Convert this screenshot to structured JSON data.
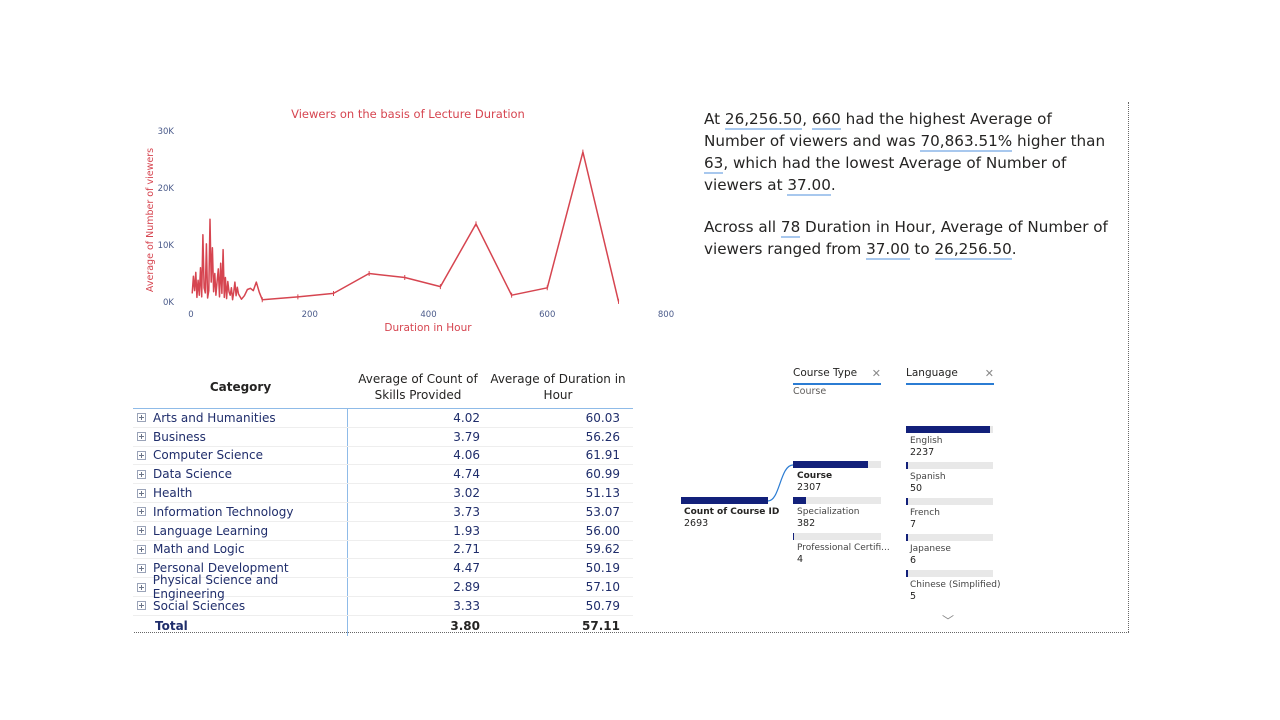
{
  "chart_data": {
    "type": "line",
    "title": "Viewers on the basis of Lecture Duration",
    "xlabel": "Duration in Hour",
    "ylabel": "Average of Number of viewers",
    "xlim": [
      0,
      800
    ],
    "ylim": [
      0,
      30000
    ],
    "x_ticks": [
      "0",
      "200",
      "400",
      "600",
      "800"
    ],
    "y_ticks": [
      "0K",
      "10K",
      "20K",
      "30K"
    ],
    "grid": false,
    "series": [
      {
        "color": "#d64550",
        "x": [
          2,
          4,
          6,
          8,
          10,
          12,
          14,
          16,
          18,
          20,
          22,
          24,
          26,
          28,
          30,
          32,
          34,
          36,
          38,
          40,
          42,
          44,
          46,
          48,
          50,
          52,
          54,
          56,
          58,
          60,
          62,
          64,
          66,
          68,
          70,
          72,
          74,
          76,
          78,
          80,
          85,
          90,
          95,
          100,
          105,
          110,
          115,
          120,
          180,
          240,
          300,
          360,
          420,
          480,
          540,
          600,
          660,
          720
        ],
        "y": [
          1500,
          4500,
          2000,
          5200,
          800,
          3800,
          1200,
          6000,
          900,
          11800,
          2500,
          1600,
          10200,
          700,
          2000,
          14500,
          3500,
          9500,
          1800,
          5000,
          1200,
          3600,
          5800,
          900,
          6800,
          1500,
          9200,
          800,
          4300,
          600,
          3600,
          1800,
          1200,
          2500,
          400,
          1800,
          3500,
          1100,
          2600,
          1400,
          500,
          1100,
          2200,
          2400,
          2000,
          3500,
          1700,
          400,
          900,
          1500,
          5000,
          4300,
          2700,
          13700,
          1200,
          2500,
          26300,
          100
        ]
      }
    ]
  },
  "narrative": {
    "p1": {
      "t1": "At ",
      "v1": "26,256.50",
      "t2": ", ",
      "v2": "660",
      "t3": " had the highest Average of Number of viewers and was ",
      "v3": "70,863.51%",
      "t4": " higher than ",
      "v4": "63",
      "t5": ", which had the lowest Average of Number of viewers at ",
      "v5": "37.00",
      "t6": "."
    },
    "p2": {
      "t1": "Across all ",
      "v1": "78",
      "t2": " Duration in Hour, Average of Number of viewers ranged from ",
      "v2": "37.00",
      "t3": " to ",
      "v3": "26,256.50",
      "t4": "."
    }
  },
  "matrix": {
    "headers": {
      "category": "Category",
      "skills_line1": "Average of Count of",
      "skills_line2": "Skills Provided",
      "duration_line1": "Average of Duration in",
      "duration_line2": "Hour"
    },
    "rows": [
      {
        "category": "Arts and Humanities",
        "skills": "4.02",
        "duration": "60.03"
      },
      {
        "category": "Business",
        "skills": "3.79",
        "duration": "56.26"
      },
      {
        "category": "Computer Science",
        "skills": "4.06",
        "duration": "61.91"
      },
      {
        "category": "Data Science",
        "skills": "4.74",
        "duration": "60.99"
      },
      {
        "category": "Health",
        "skills": "3.02",
        "duration": "51.13"
      },
      {
        "category": "Information Technology",
        "skills": "3.73",
        "duration": "53.07"
      },
      {
        "category": "Language Learning",
        "skills": "1.93",
        "duration": "56.00"
      },
      {
        "category": "Math and Logic",
        "skills": "2.71",
        "duration": "59.62"
      },
      {
        "category": "Personal Development",
        "skills": "4.47",
        "duration": "50.19"
      },
      {
        "category": "Physical Science and Engineering",
        "skills": "2.89",
        "duration": "57.10"
      },
      {
        "category": "Social Sciences",
        "skills": "3.33",
        "duration": "50.79"
      }
    ],
    "total": {
      "label": "Total",
      "skills": "3.80",
      "duration": "57.11"
    }
  },
  "tree": {
    "levels": [
      {
        "title": "Course Type",
        "subtitle": "Course"
      },
      {
        "title": "Language",
        "subtitle": ""
      }
    ],
    "root": {
      "label": "Count of Course ID",
      "value": "2693",
      "fraction": 1.0
    },
    "course_type": [
      {
        "label": "Course",
        "value": "2307",
        "fraction": 0.857
      },
      {
        "label": "Specialization",
        "value": "382",
        "fraction": 0.142
      },
      {
        "label": "Professional Certifi...",
        "value": "4",
        "fraction": 0.0015
      }
    ],
    "language": [
      {
        "label": "English",
        "value": "2237",
        "fraction": 0.97
      },
      {
        "label": "Spanish",
        "value": "50",
        "fraction": 0.022
      },
      {
        "label": "French",
        "value": "7",
        "fraction": 0.003
      },
      {
        "label": "Japanese",
        "value": "6",
        "fraction": 0.0026
      },
      {
        "label": "Chinese (Simplified)",
        "value": "5",
        "fraction": 0.0022
      }
    ],
    "icons": {
      "close": "close-icon",
      "more": "chevron-down-icon"
    }
  }
}
